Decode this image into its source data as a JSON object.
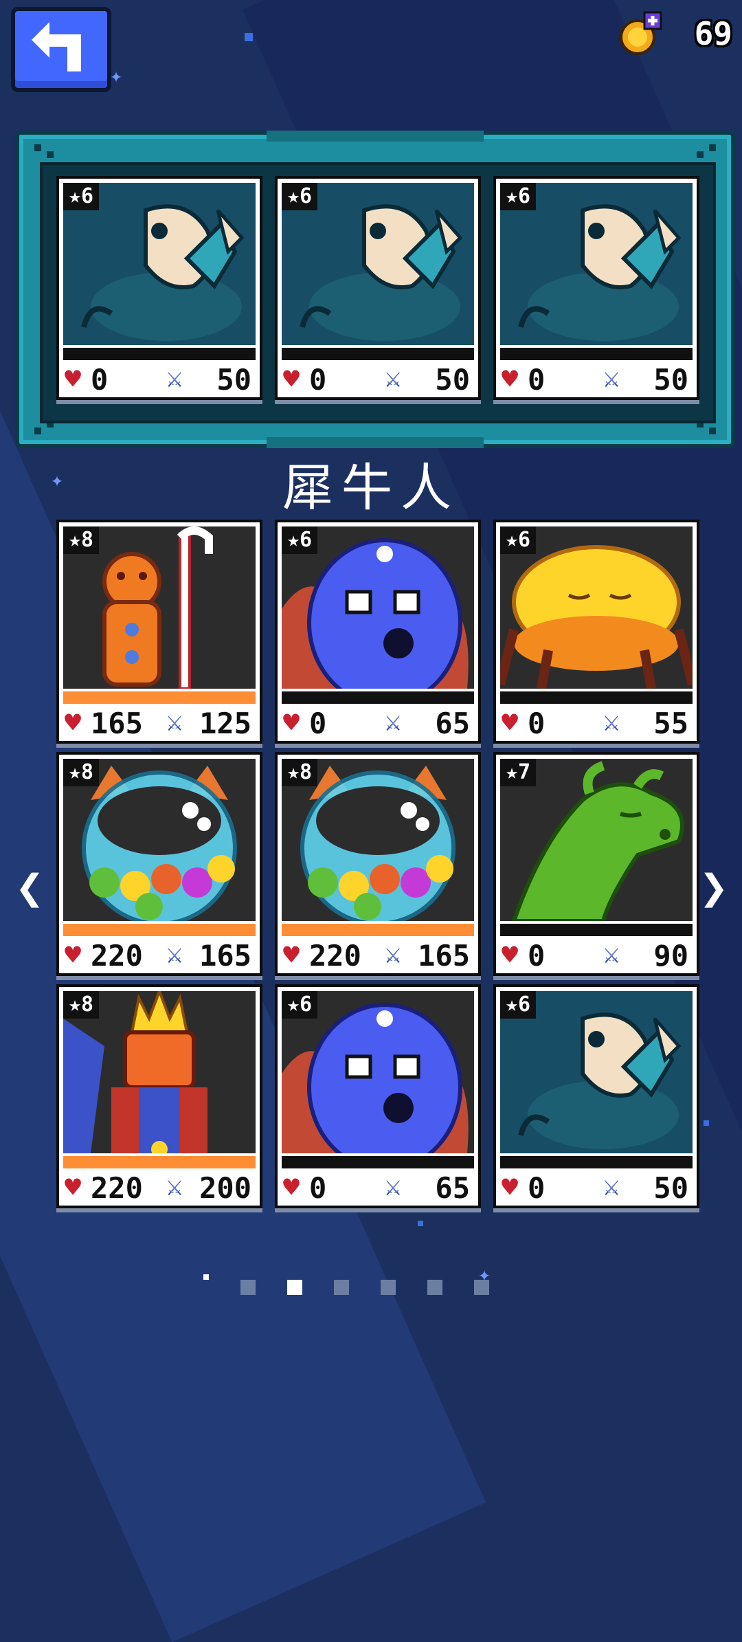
{
  "header": {
    "coin_count": "69",
    "back_icon": "back-arrow-icon",
    "coin_icon": "gold-coin-plus-icon"
  },
  "team": [
    {
      "stars": "★6",
      "hp": "0",
      "atk": "50",
      "bar": "black",
      "monster": "teal-dragon"
    },
    {
      "stars": "★6",
      "hp": "0",
      "atk": "50",
      "bar": "black",
      "monster": "teal-dragon"
    },
    {
      "stars": "★6",
      "hp": "0",
      "atk": "50",
      "bar": "black",
      "monster": "teal-dragon"
    }
  ],
  "title": "犀牛人",
  "collection": [
    {
      "stars": "★8",
      "hp": "165",
      "atk": "125",
      "bar": "orange",
      "monster": "gingerbread"
    },
    {
      "stars": "★6",
      "hp": "0",
      "atk": "65",
      "bar": "black",
      "monster": "blue-bear"
    },
    {
      "stars": "★6",
      "hp": "0",
      "atk": "55",
      "bar": "black",
      "monster": "yellow-crab"
    },
    {
      "stars": "★8",
      "hp": "220",
      "atk": "165",
      "bar": "orange",
      "monster": "gumball-cat"
    },
    {
      "stars": "★8",
      "hp": "220",
      "atk": "165",
      "bar": "orange",
      "monster": "gumball-cat"
    },
    {
      "stars": "★7",
      "hp": "0",
      "atk": "90",
      "bar": "black",
      "monster": "green-dragon"
    },
    {
      "stars": "★8",
      "hp": "220",
      "atk": "200",
      "bar": "orange",
      "monster": "fire-king"
    },
    {
      "stars": "★6",
      "hp": "0",
      "atk": "65",
      "bar": "black",
      "monster": "blue-bear"
    },
    {
      "stars": "★6",
      "hp": "0",
      "atk": "50",
      "bar": "black",
      "monster": "teal-dragon"
    }
  ],
  "navigation": {
    "prev": "❮",
    "next": "❯"
  },
  "pagination": {
    "total": 6,
    "active": 1
  },
  "colors": {
    "background": "#1c3060",
    "frame": "#1d8ea0",
    "accent_button": "#4267ff",
    "hp_bar": "#ff8d33"
  }
}
